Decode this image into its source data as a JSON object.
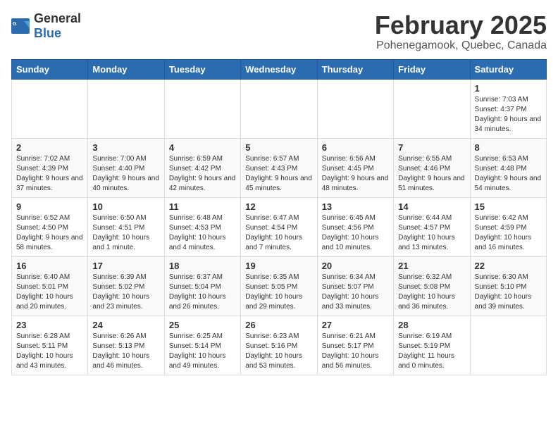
{
  "header": {
    "logo_general": "General",
    "logo_blue": "Blue",
    "month_title": "February 2025",
    "location": "Pohenegamook, Quebec, Canada"
  },
  "weekdays": [
    "Sunday",
    "Monday",
    "Tuesday",
    "Wednesday",
    "Thursday",
    "Friday",
    "Saturday"
  ],
  "weeks": [
    [
      {
        "day": null,
        "info": ""
      },
      {
        "day": null,
        "info": ""
      },
      {
        "day": null,
        "info": ""
      },
      {
        "day": null,
        "info": ""
      },
      {
        "day": null,
        "info": ""
      },
      {
        "day": null,
        "info": ""
      },
      {
        "day": "1",
        "info": "Sunrise: 7:03 AM\nSunset: 4:37 PM\nDaylight: 9 hours and 34 minutes."
      }
    ],
    [
      {
        "day": "2",
        "info": "Sunrise: 7:02 AM\nSunset: 4:39 PM\nDaylight: 9 hours and 37 minutes."
      },
      {
        "day": "3",
        "info": "Sunrise: 7:00 AM\nSunset: 4:40 PM\nDaylight: 9 hours and 40 minutes."
      },
      {
        "day": "4",
        "info": "Sunrise: 6:59 AM\nSunset: 4:42 PM\nDaylight: 9 hours and 42 minutes."
      },
      {
        "day": "5",
        "info": "Sunrise: 6:57 AM\nSunset: 4:43 PM\nDaylight: 9 hours and 45 minutes."
      },
      {
        "day": "6",
        "info": "Sunrise: 6:56 AM\nSunset: 4:45 PM\nDaylight: 9 hours and 48 minutes."
      },
      {
        "day": "7",
        "info": "Sunrise: 6:55 AM\nSunset: 4:46 PM\nDaylight: 9 hours and 51 minutes."
      },
      {
        "day": "8",
        "info": "Sunrise: 6:53 AM\nSunset: 4:48 PM\nDaylight: 9 hours and 54 minutes."
      }
    ],
    [
      {
        "day": "9",
        "info": "Sunrise: 6:52 AM\nSunset: 4:50 PM\nDaylight: 9 hours and 58 minutes."
      },
      {
        "day": "10",
        "info": "Sunrise: 6:50 AM\nSunset: 4:51 PM\nDaylight: 10 hours and 1 minute."
      },
      {
        "day": "11",
        "info": "Sunrise: 6:48 AM\nSunset: 4:53 PM\nDaylight: 10 hours and 4 minutes."
      },
      {
        "day": "12",
        "info": "Sunrise: 6:47 AM\nSunset: 4:54 PM\nDaylight: 10 hours and 7 minutes."
      },
      {
        "day": "13",
        "info": "Sunrise: 6:45 AM\nSunset: 4:56 PM\nDaylight: 10 hours and 10 minutes."
      },
      {
        "day": "14",
        "info": "Sunrise: 6:44 AM\nSunset: 4:57 PM\nDaylight: 10 hours and 13 minutes."
      },
      {
        "day": "15",
        "info": "Sunrise: 6:42 AM\nSunset: 4:59 PM\nDaylight: 10 hours and 16 minutes."
      }
    ],
    [
      {
        "day": "16",
        "info": "Sunrise: 6:40 AM\nSunset: 5:01 PM\nDaylight: 10 hours and 20 minutes."
      },
      {
        "day": "17",
        "info": "Sunrise: 6:39 AM\nSunset: 5:02 PM\nDaylight: 10 hours and 23 minutes."
      },
      {
        "day": "18",
        "info": "Sunrise: 6:37 AM\nSunset: 5:04 PM\nDaylight: 10 hours and 26 minutes."
      },
      {
        "day": "19",
        "info": "Sunrise: 6:35 AM\nSunset: 5:05 PM\nDaylight: 10 hours and 29 minutes."
      },
      {
        "day": "20",
        "info": "Sunrise: 6:34 AM\nSunset: 5:07 PM\nDaylight: 10 hours and 33 minutes."
      },
      {
        "day": "21",
        "info": "Sunrise: 6:32 AM\nSunset: 5:08 PM\nDaylight: 10 hours and 36 minutes."
      },
      {
        "day": "22",
        "info": "Sunrise: 6:30 AM\nSunset: 5:10 PM\nDaylight: 10 hours and 39 minutes."
      }
    ],
    [
      {
        "day": "23",
        "info": "Sunrise: 6:28 AM\nSunset: 5:11 PM\nDaylight: 10 hours and 43 minutes."
      },
      {
        "day": "24",
        "info": "Sunrise: 6:26 AM\nSunset: 5:13 PM\nDaylight: 10 hours and 46 minutes."
      },
      {
        "day": "25",
        "info": "Sunrise: 6:25 AM\nSunset: 5:14 PM\nDaylight: 10 hours and 49 minutes."
      },
      {
        "day": "26",
        "info": "Sunrise: 6:23 AM\nSunset: 5:16 PM\nDaylight: 10 hours and 53 minutes."
      },
      {
        "day": "27",
        "info": "Sunrise: 6:21 AM\nSunset: 5:17 PM\nDaylight: 10 hours and 56 minutes."
      },
      {
        "day": "28",
        "info": "Sunrise: 6:19 AM\nSunset: 5:19 PM\nDaylight: 11 hours and 0 minutes."
      },
      {
        "day": null,
        "info": ""
      }
    ]
  ]
}
